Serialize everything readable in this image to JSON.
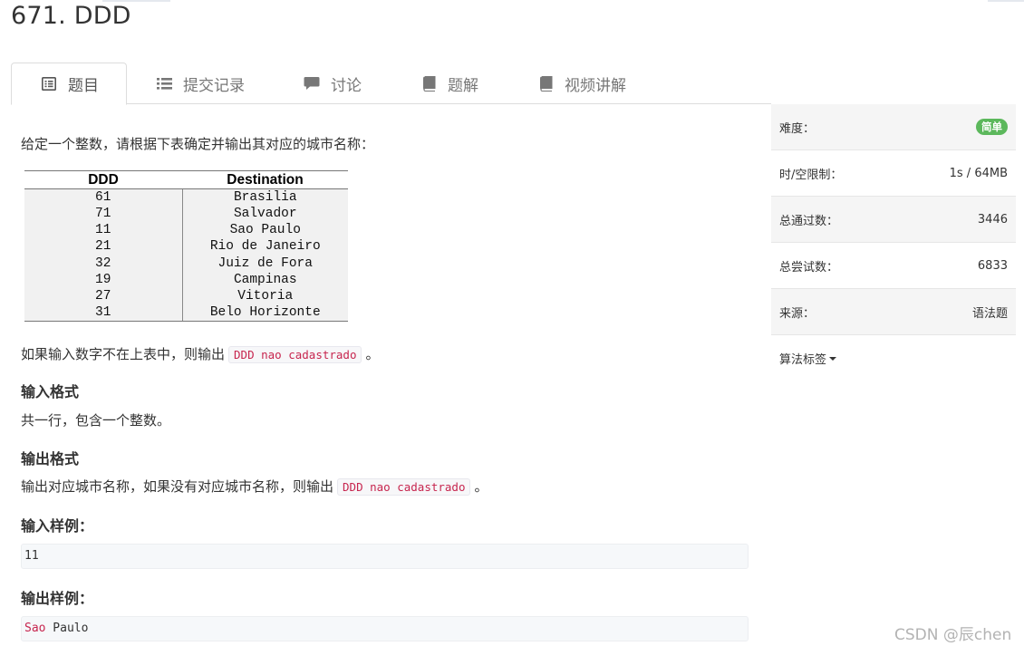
{
  "problem": {
    "title": "671. DDD"
  },
  "tabs": [
    {
      "label": "题目",
      "icon": "list-alt-icon",
      "active": true
    },
    {
      "label": "提交记录",
      "icon": "list-icon",
      "active": false
    },
    {
      "label": "讨论",
      "icon": "comment-icon",
      "active": false
    },
    {
      "label": "题解",
      "icon": "book-icon",
      "active": false
    },
    {
      "label": "视频讲解",
      "icon": "book-icon",
      "active": false
    }
  ],
  "body": {
    "intro": "给定一个整数，请根据下表确定并输出其对应的城市名称：",
    "table": {
      "headers": [
        "DDD",
        "Destination"
      ],
      "rows": [
        [
          "61",
          "Brasilia"
        ],
        [
          "71",
          "Salvador"
        ],
        [
          "11",
          "Sao Paulo"
        ],
        [
          "21",
          "Rio de Janeiro"
        ],
        [
          "32",
          "Juiz de Fora"
        ],
        [
          "19",
          "Campinas"
        ],
        [
          "27",
          "Vitoria"
        ],
        [
          "31",
          "Belo Horizonte"
        ]
      ]
    },
    "not_found_prefix": "如果输入数字不在上表中，则输出",
    "not_found_code": "DDD nao cadastrado",
    "not_found_suffix": "。",
    "input_format_title": "输入格式",
    "input_format_text": "共一行，包含一个整数。",
    "output_format_title": "输出格式",
    "output_format_prefix": "输出对应城市名称，如果没有对应城市名称，则输出",
    "output_format_code": "DDD nao cadastrado",
    "output_format_suffix": "。",
    "input_sample_title": "输入样例：",
    "input_sample": "11",
    "output_sample_title": "输出样例：",
    "output_sample_kw": "Sao",
    "output_sample_rest": " Paulo"
  },
  "side": {
    "difficulty_label": "难度：",
    "difficulty_value": "简单",
    "difficulty_color": "#5cb85c",
    "limit_label": "时/空限制：",
    "limit_value": "1s / 64MB",
    "passed_label": "总通过数：",
    "passed_value": "3446",
    "attempts_label": "总尝试数：",
    "attempts_value": "6833",
    "source_label": "来源：",
    "source_value": "语法题",
    "tags_label": "算法标签"
  },
  "watermark": "CSDN @辰chen"
}
